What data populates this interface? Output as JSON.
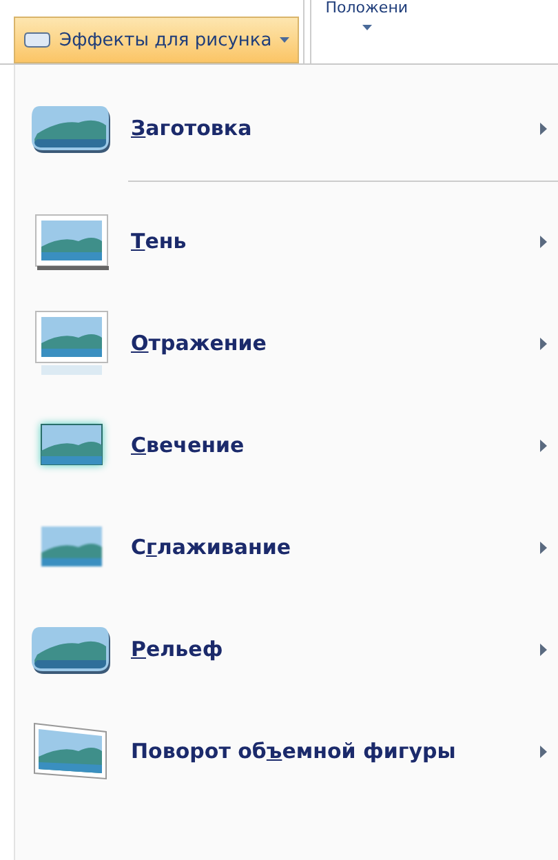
{
  "ribbon": {
    "effects_button": {
      "label": "Эффекты для рисунка",
      "selected": true
    },
    "position_button": {
      "label": "Положени"
    }
  },
  "menu": {
    "items": [
      {
        "kind": "preset",
        "key": "З",
        "after": "аготовка",
        "separator_after": true
      },
      {
        "kind": "shadow",
        "key": "Т",
        "after": "ень",
        "separator_after": false
      },
      {
        "kind": "reflection",
        "key": "О",
        "after": "тражение",
        "separator_after": false
      },
      {
        "kind": "glow",
        "key": "С",
        "after": "вечение",
        "separator_after": false
      },
      {
        "kind": "soft",
        "before": "С",
        "key": "г",
        "after": "лаживание",
        "separator_after": false
      },
      {
        "kind": "bevel",
        "key": "Р",
        "after": "ельеф",
        "separator_after": false
      },
      {
        "kind": "rotation",
        "before": "Поворот об",
        "key": "ъ",
        "after": "емной фигуры",
        "separator_after": false
      }
    ]
  }
}
